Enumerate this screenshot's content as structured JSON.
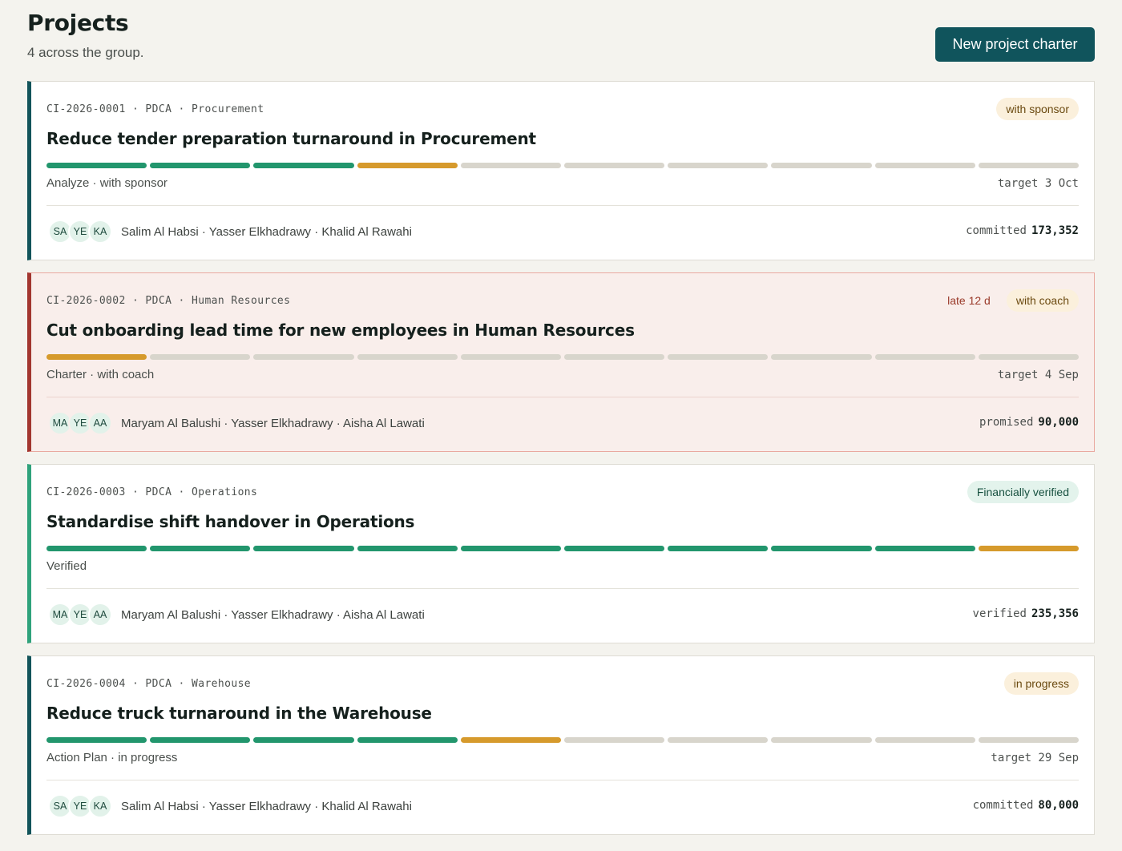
{
  "header": {
    "title": "Projects",
    "subtitle": "4 across the group.",
    "new_button": "New project charter"
  },
  "projects": [
    {
      "meta": "CI-2026-0001 · PDCA · Procurement",
      "late": "",
      "badge": "with sponsor",
      "title": "Reduce tender preparation turnaround in Procurement",
      "progress_steps": 10,
      "progress_done": 3,
      "progress_current": 4,
      "stage": "Analyze · with sponsor",
      "target": "target 3 Oct",
      "initials": [
        "SA",
        "YE",
        "KA"
      ],
      "members": "Salim Al Habsi · Yasser Elkhadrawy · Khalid Al Rawahi",
      "money_label": "committed",
      "money_value": "173,352"
    },
    {
      "meta": "CI-2026-0002 · PDCA · Human Resources",
      "late": "late 12 d",
      "badge": "with coach",
      "title": "Cut onboarding lead time for new employees in Human Resources",
      "progress_steps": 10,
      "progress_done": 0,
      "progress_current": 1,
      "stage": "Charter · with coach",
      "target": "target 4 Sep",
      "initials": [
        "MA",
        "YE",
        "AA"
      ],
      "members": "Maryam Al Balushi · Yasser Elkhadrawy · Aisha Al Lawati",
      "money_label": "promised",
      "money_value": "90,000"
    },
    {
      "meta": "CI-2026-0003 · PDCA · Operations",
      "late": "",
      "badge": "Financially verified",
      "title": "Standardise shift handover in Operations",
      "progress_steps": 10,
      "progress_done": 9,
      "progress_current": 10,
      "stage": "Verified",
      "target": "",
      "initials": [
        "MA",
        "YE",
        "AA"
      ],
      "members": "Maryam Al Balushi · Yasser Elkhadrawy · Aisha Al Lawati",
      "money_label": "verified",
      "money_value": "235,356"
    },
    {
      "meta": "CI-2026-0004 · PDCA · Warehouse",
      "late": "",
      "badge": "in progress",
      "title": "Reduce truck turnaround in the Warehouse",
      "progress_steps": 10,
      "progress_done": 4,
      "progress_current": 5,
      "stage": "Action Plan · in progress",
      "target": "target 29 Sep",
      "initials": [
        "SA",
        "YE",
        "KA"
      ],
      "members": "Salim Al Habsi · Yasser Elkhadrawy · Khalid Al Rawahi",
      "money_label": "committed",
      "money_value": "80,000"
    }
  ],
  "colors": {
    "primary": "#10545c",
    "done": "#22966d",
    "current": "#d69a2c",
    "pending": "#d8d5cc",
    "late_accent": "#a2362f"
  }
}
